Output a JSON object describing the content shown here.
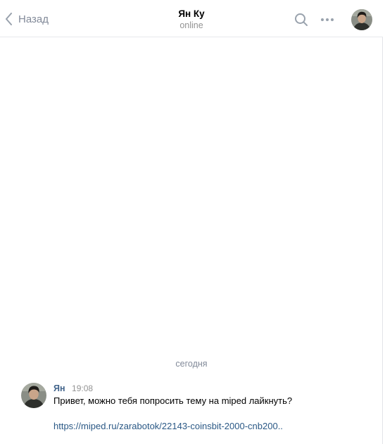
{
  "header": {
    "back_label": "Назад",
    "peer_name": "Ян Ку",
    "peer_status": "online",
    "back_icon": "chevron-left-icon",
    "search_icon": "search-icon",
    "more_icon": "more-horizontal-icon"
  },
  "history": {
    "date_separator": "сегодня",
    "messages": [
      {
        "author": "Ян",
        "time": "19:08",
        "text": "Привет, можно тебя попросить тему на miped лайкнуть?",
        "link": "https://miped.ru/zarabotok/22143-coinsbit-2000-cnb200.."
      }
    ]
  },
  "colors": {
    "link": "#2a5885",
    "author": "#42648b",
    "muted": "#828a99",
    "divider": "#e7e8ec"
  }
}
